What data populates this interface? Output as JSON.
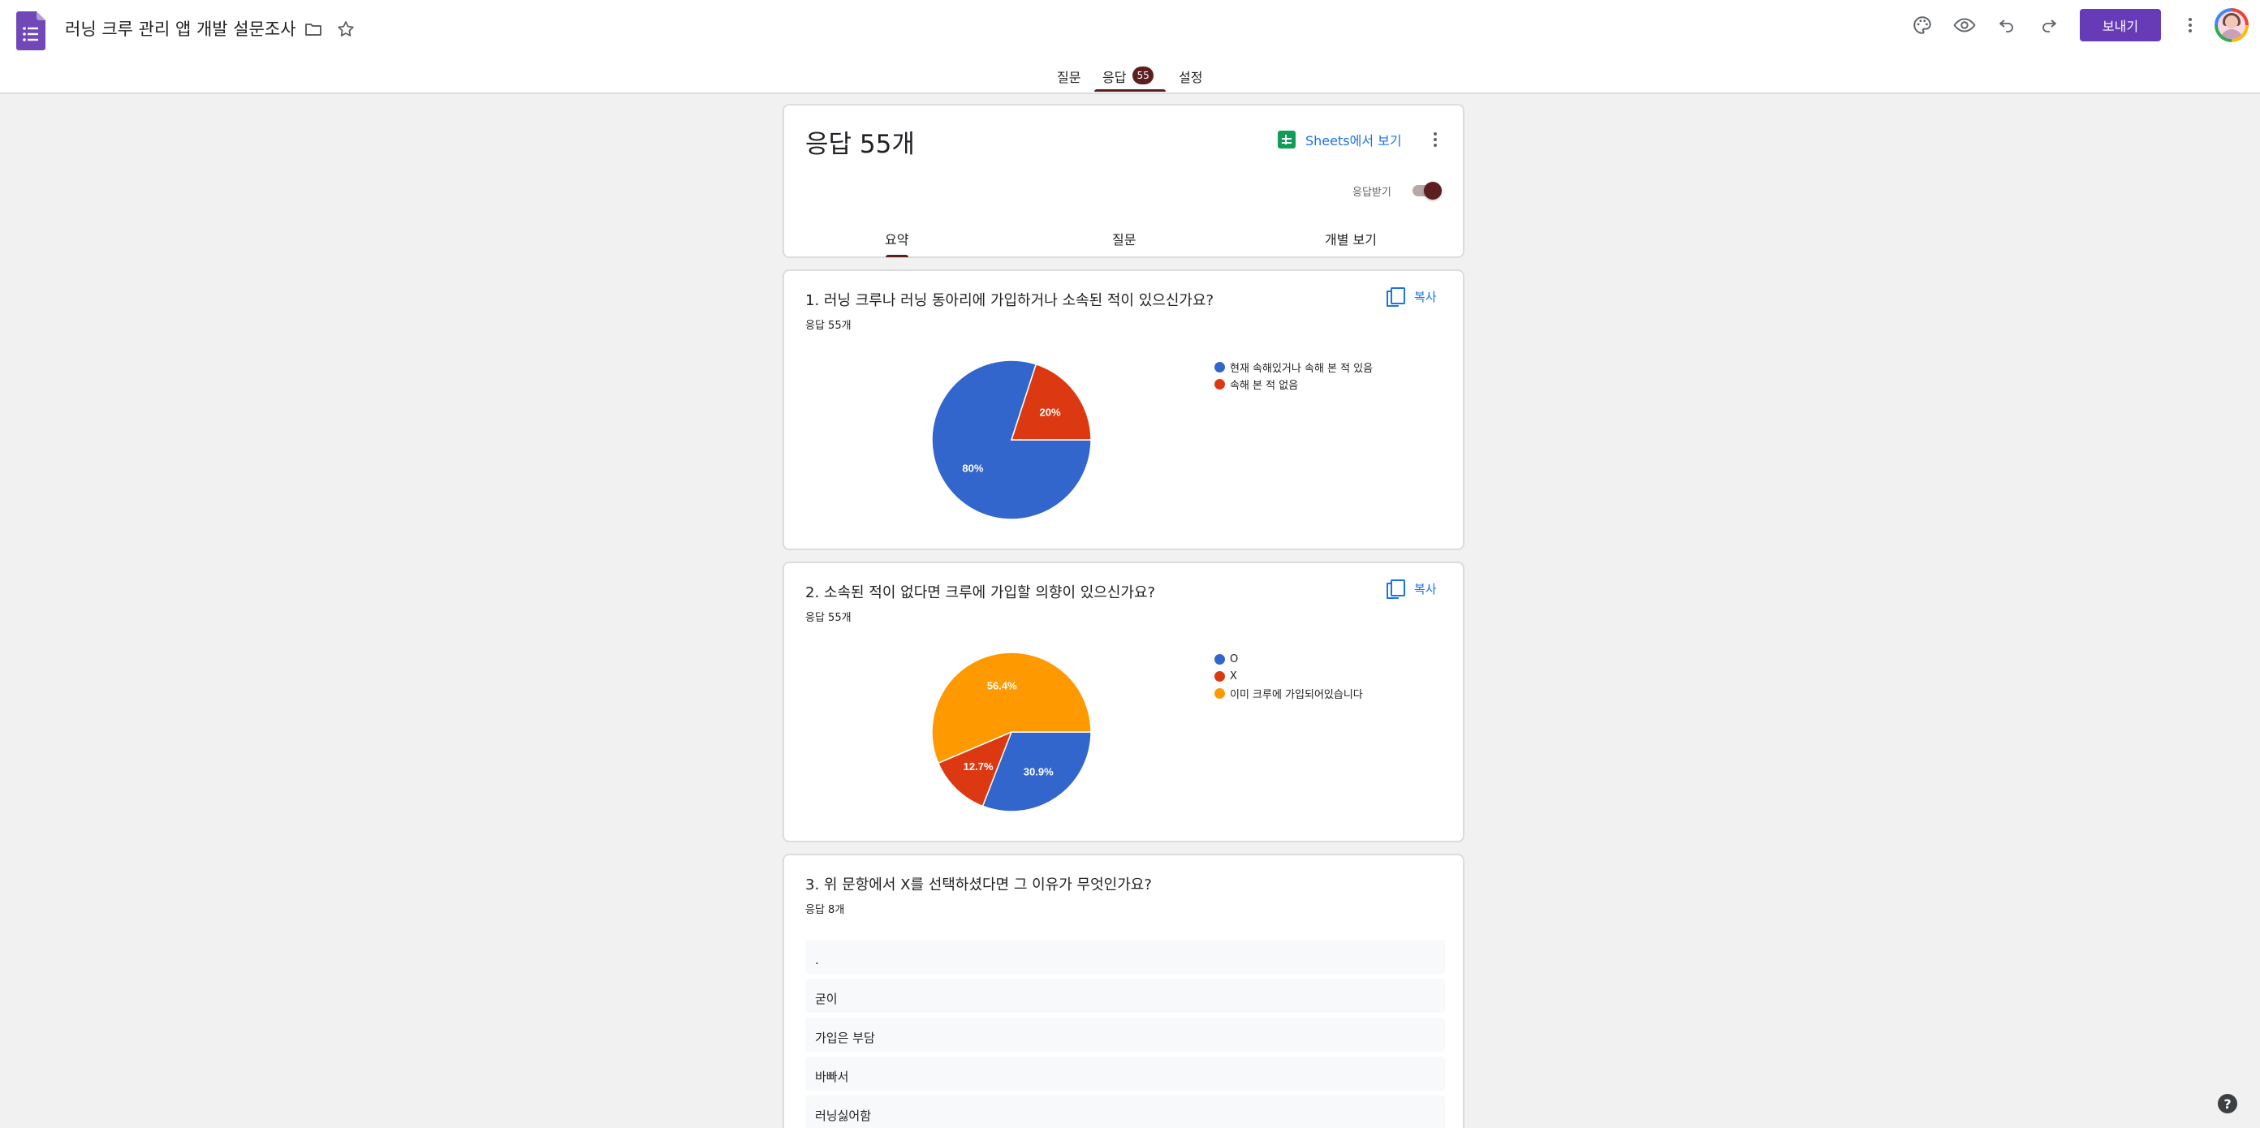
{
  "app": {
    "doc_title": "러닝 크루 관리 앱 개발 설문조사",
    "send_label": "보내기",
    "colors": {
      "accent": "#673ab7",
      "theme": "#5b1f1f",
      "link": "#1a73e8"
    }
  },
  "tabs": [
    {
      "label": "질문"
    },
    {
      "label": "응답",
      "badge": "55"
    },
    {
      "label": "설정"
    }
  ],
  "responses": {
    "title": "응답 55개",
    "sheets_label": "Sheets에서 보기",
    "accepting_label": "응답받기",
    "accepting": true,
    "sub_tabs": [
      {
        "label": "요약"
      },
      {
        "label": "질문"
      },
      {
        "label": "개별 보기"
      }
    ]
  },
  "questions": [
    {
      "title": "1. 러닝 크루나 러닝 동아리에 가입하거나 소속된 적이 있으신가요?",
      "count": "응답 55개",
      "copy_label": "복사",
      "chart_data": {
        "type": "pie",
        "series": [
          {
            "name": "현재 속해있거나 속해 본 적 있음",
            "value": 80,
            "label": "80%",
            "color": "#3366cc"
          },
          {
            "name": "속해 본 적 없음",
            "value": 20,
            "label": "20%",
            "color": "#dc3912"
          }
        ],
        "legend_position": "right"
      }
    },
    {
      "title": "2. 소속된 적이 없다면 크루에 가입할 의향이 있으신가요?",
      "count": "응답 55개",
      "copy_label": "복사",
      "chart_data": {
        "type": "pie",
        "series": [
          {
            "name": "O",
            "value": 30.9,
            "label": "30.9%",
            "color": "#3366cc"
          },
          {
            "name": "X",
            "value": 12.7,
            "label": "12.7%",
            "color": "#dc3912"
          },
          {
            "name": "이미 크루에 가입되어있습니다",
            "value": 56.4,
            "label": "56.4%",
            "color": "#ff9900"
          }
        ],
        "legend_position": "right"
      }
    },
    {
      "title": "3. 위 문항에서 X를 선택하셨다면 그 이유가 무엇인가요?",
      "count": "응답 8개",
      "answers": [
        ".",
        "굳이",
        "가입은 부담",
        "바빠서",
        "러닝싫어함"
      ]
    }
  ],
  "icons": [
    "forms-logo-icon",
    "folder-icon",
    "star-icon",
    "palette-icon",
    "preview-icon",
    "undo-icon",
    "redo-icon",
    "more-vert-icon",
    "sheets-icon",
    "copy-icon",
    "help-icon"
  ]
}
